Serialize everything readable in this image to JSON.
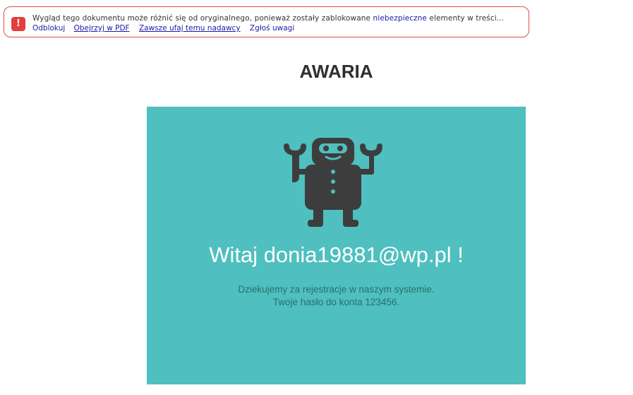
{
  "warning": {
    "text_before": "Wygląd tego dokumentu może różnić się od oryginalnego, ponieważ zostały zablokowane",
    "text_highlight": "niebezpieczne",
    "text_after": "elementy w treści...",
    "links": {
      "unblock": "Odblokuj",
      "view_pdf": "Obejrzyj w PDF",
      "trust_sender": "Zawsze ufaj temu nadawcy",
      "report": "Zgłoś uwagi"
    },
    "icon": "exclamation-icon"
  },
  "email": {
    "title": "AWARIA",
    "greeting": "Witaj donia19881@wp.pl !",
    "message_line1": "Dziekujemy za rejestracje w naszym systemie.",
    "message_line2": "Twoje hasło do konta 123456.",
    "illustration": "robot-icon"
  },
  "colors": {
    "card_background": "#4fbfbf",
    "warning_border": "#e24a4a",
    "warning_icon": "#e53e3e",
    "link": "#1a1aa6",
    "robot": "#3d3d3d"
  }
}
